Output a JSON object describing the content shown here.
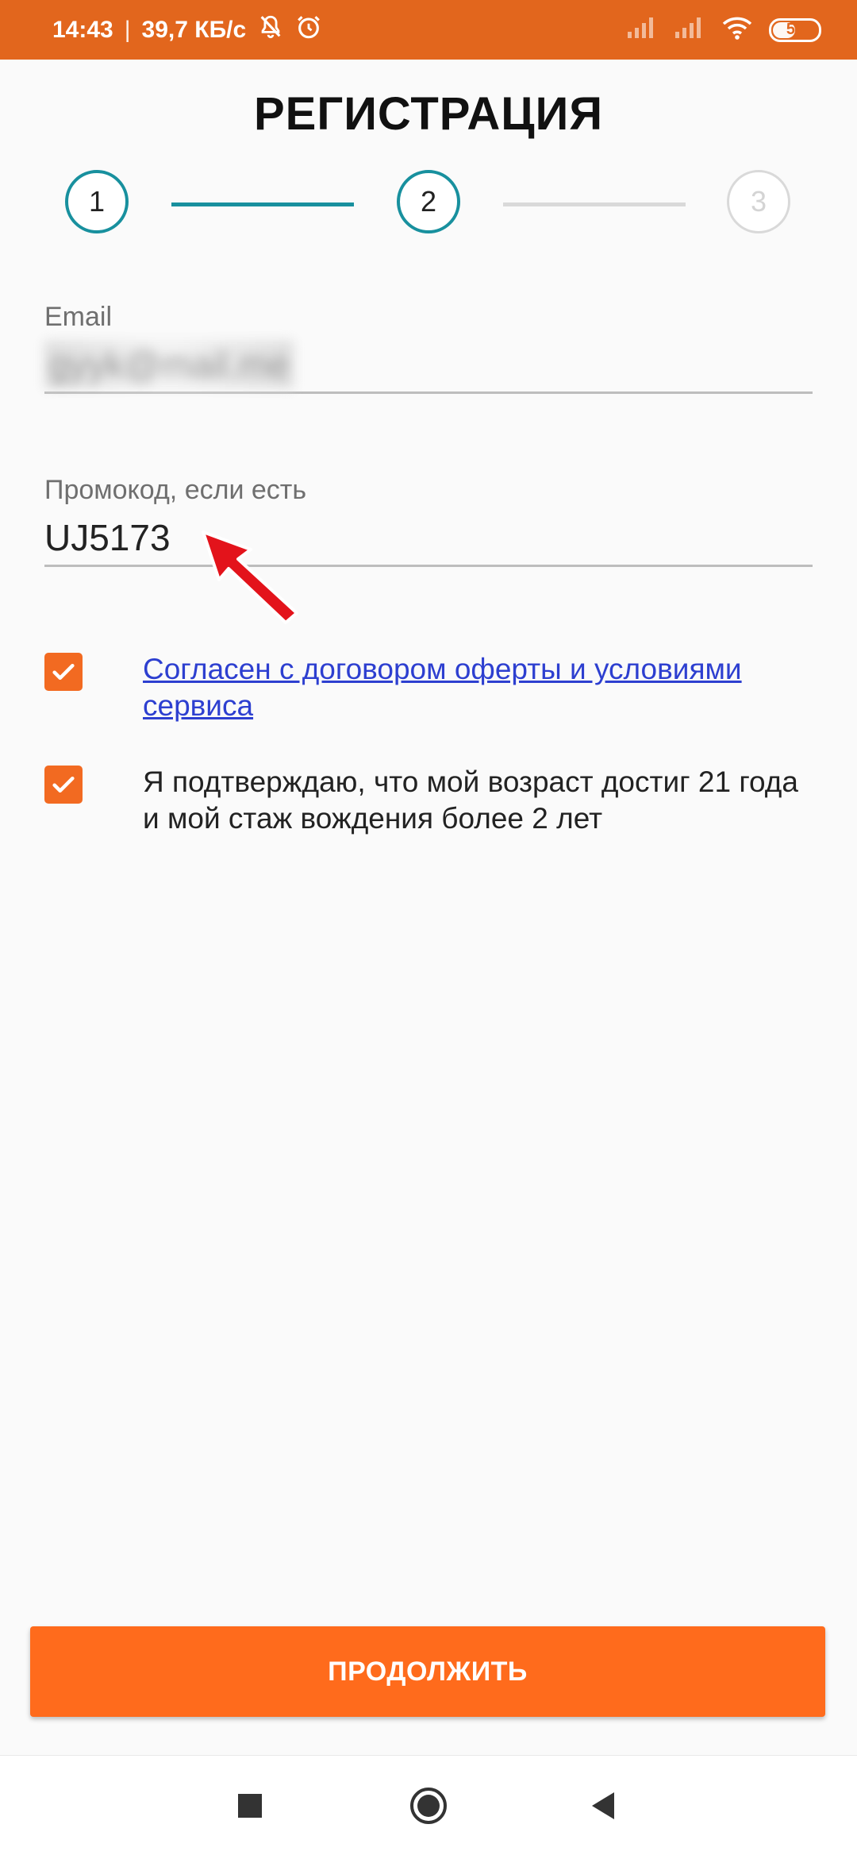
{
  "status_bar": {
    "time": "14:43",
    "separator": "|",
    "speed": "39,7 КБ/с",
    "battery": "53",
    "battery_level_percent": 53
  },
  "page": {
    "title": "РЕГИСТРАЦИЯ"
  },
  "stepper": {
    "steps": [
      {
        "label": "1",
        "state": "done"
      },
      {
        "label": "2",
        "state": "current"
      },
      {
        "label": "3",
        "state": "pending"
      }
    ],
    "active_color": "#18909e",
    "inactive_color": "#d9d9d9"
  },
  "form": {
    "email": {
      "label": "Email",
      "value": "gyyk@mail.me"
    },
    "promo": {
      "label": "Промокод, если есть",
      "value": "UJ5173"
    }
  },
  "agreements": [
    {
      "text": "Согласен с договором оферты и условиями сервиса",
      "checked": true,
      "is_link": true
    },
    {
      "text": "Я подтверждаю, что мой возраст достиг 21 года и мой стаж вождения более 2 лет",
      "checked": true,
      "is_link": false
    }
  ],
  "actions": {
    "continue_label": "ПРОДОЛЖИТЬ"
  },
  "colors": {
    "accent": "#ff6b1c",
    "status_bar": "#e2661d",
    "link": "#2d3fd0",
    "annotation_arrow": "#e3131b"
  },
  "icons": {
    "status": [
      "muted-bell-icon",
      "alarm-icon",
      "signal-icon",
      "signal-icon",
      "wifi-icon",
      "battery-icon"
    ],
    "checkbox": "checkmark-icon",
    "annotation": "red-arrow-icon",
    "nav": [
      "square-recents-icon",
      "circle-home-icon",
      "triangle-back-icon"
    ]
  }
}
